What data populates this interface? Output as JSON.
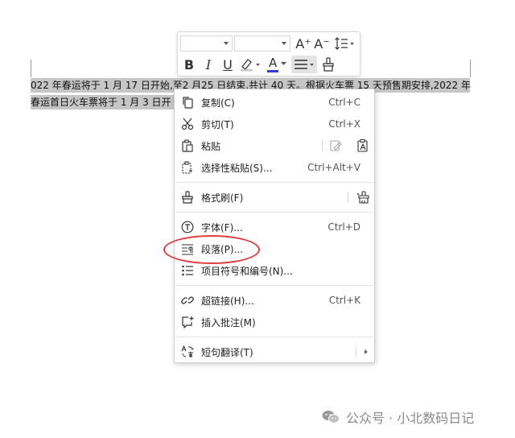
{
  "document": {
    "line1": "022  年春运将于 1  月  17 日开始,至2 月25  日结束,共计 40 天。根据火车票 15 天预售期安排,2022  年",
    "line2": "春运首日火车票将于 1 月 3  日开"
  },
  "toolbar": {
    "font_name_value": "",
    "font_size_value": "",
    "grow_font_icon": "A⁺",
    "shrink_font_icon": "A⁻",
    "bold_label": "B",
    "italic_label": "I",
    "underline_label": "U",
    "font_color_label": "A"
  },
  "menu": {
    "copy": {
      "label": "复制(C)",
      "shortcut": "Ctrl+C"
    },
    "cut": {
      "label": "剪切(T)",
      "shortcut": "Ctrl+X"
    },
    "paste": {
      "label": "粘贴"
    },
    "paste_special": {
      "label": "选择性粘贴(S)...",
      "shortcut": "Ctrl+Alt+V"
    },
    "format_painter": {
      "label": "格式刷(F)"
    },
    "font": {
      "label": "字体(F)...",
      "shortcut": "Ctrl+D"
    },
    "paragraph": {
      "label": "段落(P)..."
    },
    "bullets": {
      "label": "项目符号和编号(N)..."
    },
    "hyperlink": {
      "label": "超链接(H)...",
      "shortcut": "Ctrl+K"
    },
    "comment": {
      "label": "插入批注(M)"
    },
    "translate": {
      "label": "短句翻译(T)"
    }
  },
  "watermark": {
    "text": "公众号 · 小北数码日记"
  },
  "colors": {
    "highlight_oval": "#e23b3b",
    "font_color_underline": "#2b3fd6",
    "highlighter": "#c9c9c9"
  }
}
